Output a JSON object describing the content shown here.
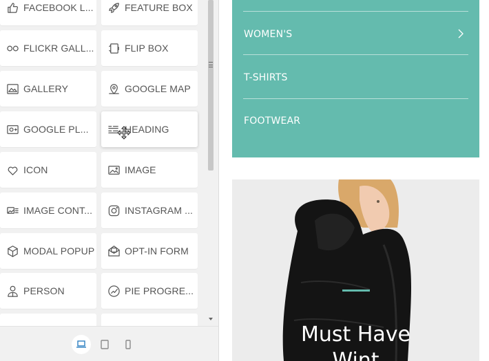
{
  "widgets": [
    {
      "label": "FACEBOOK L...",
      "icon": "thumbs-up-icon"
    },
    {
      "label": "FEATURE BOX",
      "icon": "rocket-icon"
    },
    {
      "label": "FLICKR GALL...",
      "icon": "flickr-dots-icon"
    },
    {
      "label": "FLIP BOX",
      "icon": "flip-box-icon"
    },
    {
      "label": "GALLERY",
      "icon": "gallery-icon"
    },
    {
      "label": "GOOGLE MAP",
      "icon": "map-pin-icon"
    },
    {
      "label": "GOOGLE PL...",
      "icon": "google-plus-icon"
    },
    {
      "label": "HEADING",
      "icon": "heading-icon"
    },
    {
      "label": "ICON",
      "icon": "heart-icon"
    },
    {
      "label": "IMAGE",
      "icon": "image-icon"
    },
    {
      "label": "IMAGE CONT...",
      "icon": "image-content-icon"
    },
    {
      "label": "INSTAGRAM ...",
      "icon": "instagram-icon"
    },
    {
      "label": "MODAL POPUP",
      "icon": "cube-icon"
    },
    {
      "label": "OPT-IN FORM",
      "icon": "envelope-icon"
    },
    {
      "label": "PERSON",
      "icon": "person-icon"
    },
    {
      "label": "PIE PROGRE...",
      "icon": "pie-progress-icon"
    }
  ],
  "devices": [
    {
      "name": "desktop",
      "icon": "laptop-icon",
      "active": true
    },
    {
      "name": "tablet",
      "icon": "tablet-icon",
      "active": false
    },
    {
      "name": "mobile",
      "icon": "mobile-icon",
      "active": false
    }
  ],
  "preview": {
    "menu_items": [
      "WOMEN'S",
      "T-SHIRTS",
      "FOOTWEAR"
    ],
    "hero_title": "Must Have",
    "hero_subtitle": "Wint",
    "colors": {
      "accent": "#64bbae",
      "text": "#ffffff"
    }
  }
}
